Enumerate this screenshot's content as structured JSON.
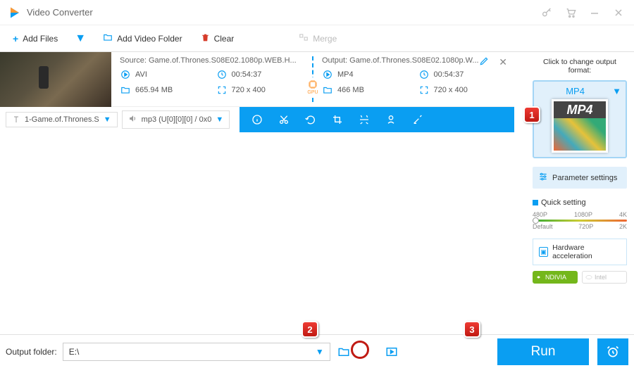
{
  "titlebar": {
    "title": "Video Converter"
  },
  "toolbar": {
    "add_files": "Add Files",
    "add_folder": "Add Video Folder",
    "clear": "Clear",
    "merge": "Merge"
  },
  "item": {
    "source_label": "Source: Game.of.Thrones.S08E02.1080p.WEB.H...",
    "output_label": "Output: Game.of.Thrones.S08E02.1080p.W...",
    "src": {
      "format": "AVI",
      "duration": "00:54:37",
      "size": "665.94 MB",
      "resolution": "720 x 400"
    },
    "out": {
      "format": "MP4",
      "duration": "00:54:37",
      "size": "466 MB",
      "resolution": "720 x 400"
    },
    "gpu": "GPU"
  },
  "sub": {
    "subtitle": "1-Game.of.Thrones.S",
    "audio": "mp3 (U[0][0][0] / 0x0"
  },
  "sidebar": {
    "change_label": "Click to change output format:",
    "format_name": "MP4",
    "thumb_label": "MP4",
    "param_settings": "Parameter settings",
    "quick_setting": "Quick setting",
    "ticks_top": [
      "480P",
      "1080P",
      "4K"
    ],
    "ticks_bottom": [
      "Default",
      "720P",
      "2K"
    ],
    "hw_accel": "Hardware acceleration",
    "nvidia": "NDIVIA",
    "intel": "Intel"
  },
  "bottom": {
    "label": "Output folder:",
    "path": "E:\\",
    "run": "Run"
  },
  "callouts": {
    "one": "1",
    "two": "2",
    "three": "3"
  }
}
